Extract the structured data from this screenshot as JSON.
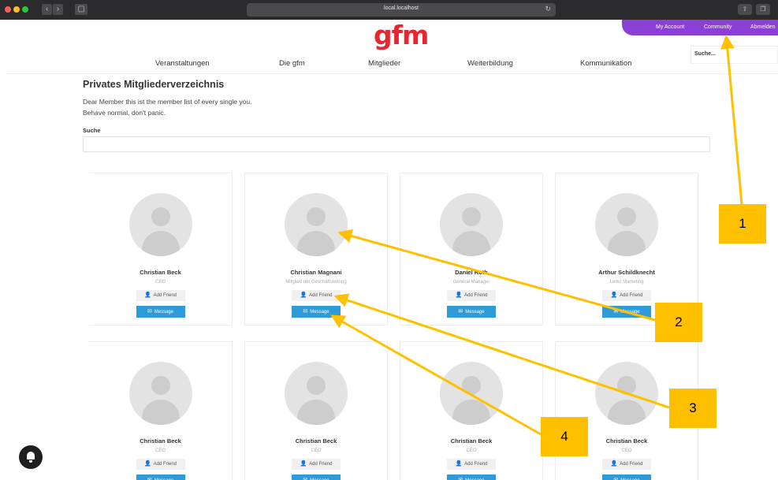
{
  "browser": {
    "url": "local.localhost",
    "back_icon": "‹",
    "forward_icon": "›",
    "sidebar_icon": "▢",
    "reload_icon": "↻",
    "share_icon": "⇪",
    "tabs_icon": "❐"
  },
  "site": {
    "logo": "gfm",
    "topnav": [
      "My Account",
      "Community",
      "Abmelden"
    ],
    "mainnav": [
      "Veranstaltungen",
      "Die gfm",
      "Mitglieder",
      "Weiterbildung",
      "Kommunikation"
    ],
    "search_placeholder": "Suche..."
  },
  "directory": {
    "title": "Privates Mitgliederverzeichnis",
    "intro_line1": "Dear Member this ist the member list of every single you.",
    "intro_line2": "Behave normal, don't panic.",
    "search_label": "Suche",
    "add_friend_label": "Add Friend",
    "message_label": "Message",
    "members": [
      {
        "name": "Christian Beck",
        "role": "CEO"
      },
      {
        "name": "Christian Magnani",
        "role": "Mitglied der Geschäftsleitung"
      },
      {
        "name": "Daniel Roth",
        "role": "General Manager"
      },
      {
        "name": "Arthur Schildknecht",
        "role": "Leiter Marketing"
      },
      {
        "name": "Christian Beck",
        "role": "CEO"
      },
      {
        "name": "Christian Beck",
        "role": "CEO"
      },
      {
        "name": "Christian Beck",
        "role": "CEO"
      },
      {
        "name": "Christian Beck",
        "role": "CEO"
      }
    ]
  },
  "annotations": {
    "labels": [
      "1",
      "2",
      "3",
      "4"
    ],
    "color": "#ffc000"
  }
}
